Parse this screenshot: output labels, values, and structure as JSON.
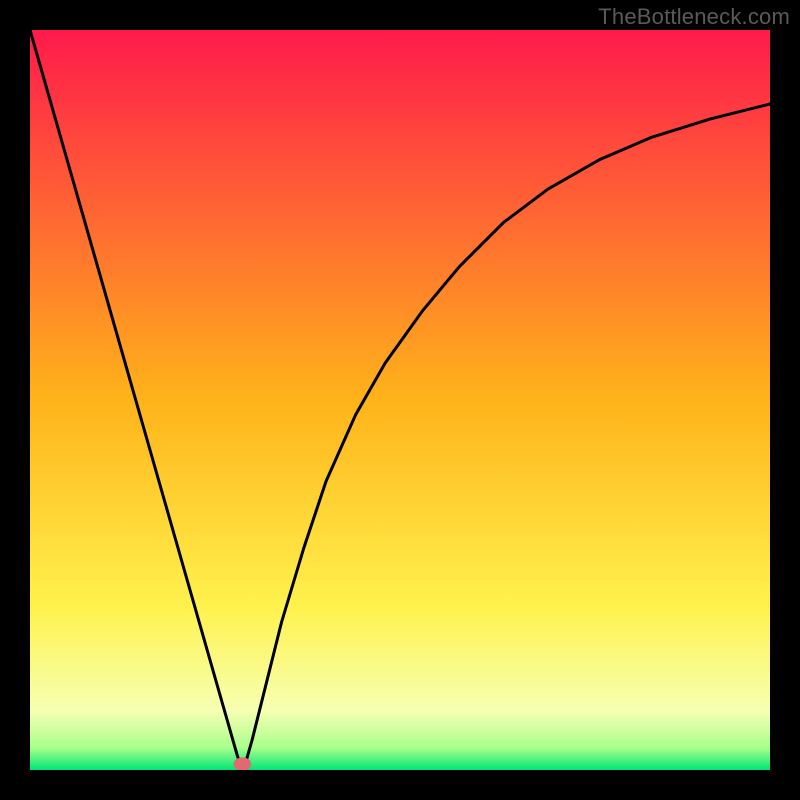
{
  "watermark": "TheBottleneck.com",
  "chart_data": {
    "type": "line",
    "title": "",
    "xlabel": "",
    "ylabel": "",
    "xlim": [
      0,
      100
    ],
    "ylim": [
      0,
      100
    ],
    "grid": false,
    "background_gradient": {
      "stops": [
        {
          "offset": 0.0,
          "color": "#ff1a4b"
        },
        {
          "offset": 0.5,
          "color": "#ffb31a"
        },
        {
          "offset": 0.78,
          "color": "#fff24d"
        },
        {
          "offset": 0.92,
          "color": "#f6ffb3"
        },
        {
          "offset": 0.97,
          "color": "#a9ff8c"
        },
        {
          "offset": 1.0,
          "color": "#00e676"
        }
      ]
    },
    "series": [
      {
        "name": "bottleneck-curve",
        "color": "#000000",
        "x": [
          0,
          4,
          8,
          12,
          16,
          20,
          24,
          26,
          28,
          28.5,
          29,
          30,
          32,
          34,
          37,
          40,
          44,
          48,
          53,
          58,
          64,
          70,
          77,
          84,
          92,
          100
        ],
        "y": [
          100,
          86,
          72,
          58,
          44,
          30,
          16,
          9,
          2,
          0.5,
          0.5,
          4,
          12,
          20,
          30,
          39,
          48,
          55,
          62,
          68,
          74,
          78.5,
          82.5,
          85.5,
          88,
          90
        ]
      }
    ],
    "marker": {
      "name": "optimal-point",
      "x": 28.7,
      "y": 0.8,
      "rx": 1.2,
      "ry": 0.9,
      "color": "#e06a6f"
    }
  }
}
